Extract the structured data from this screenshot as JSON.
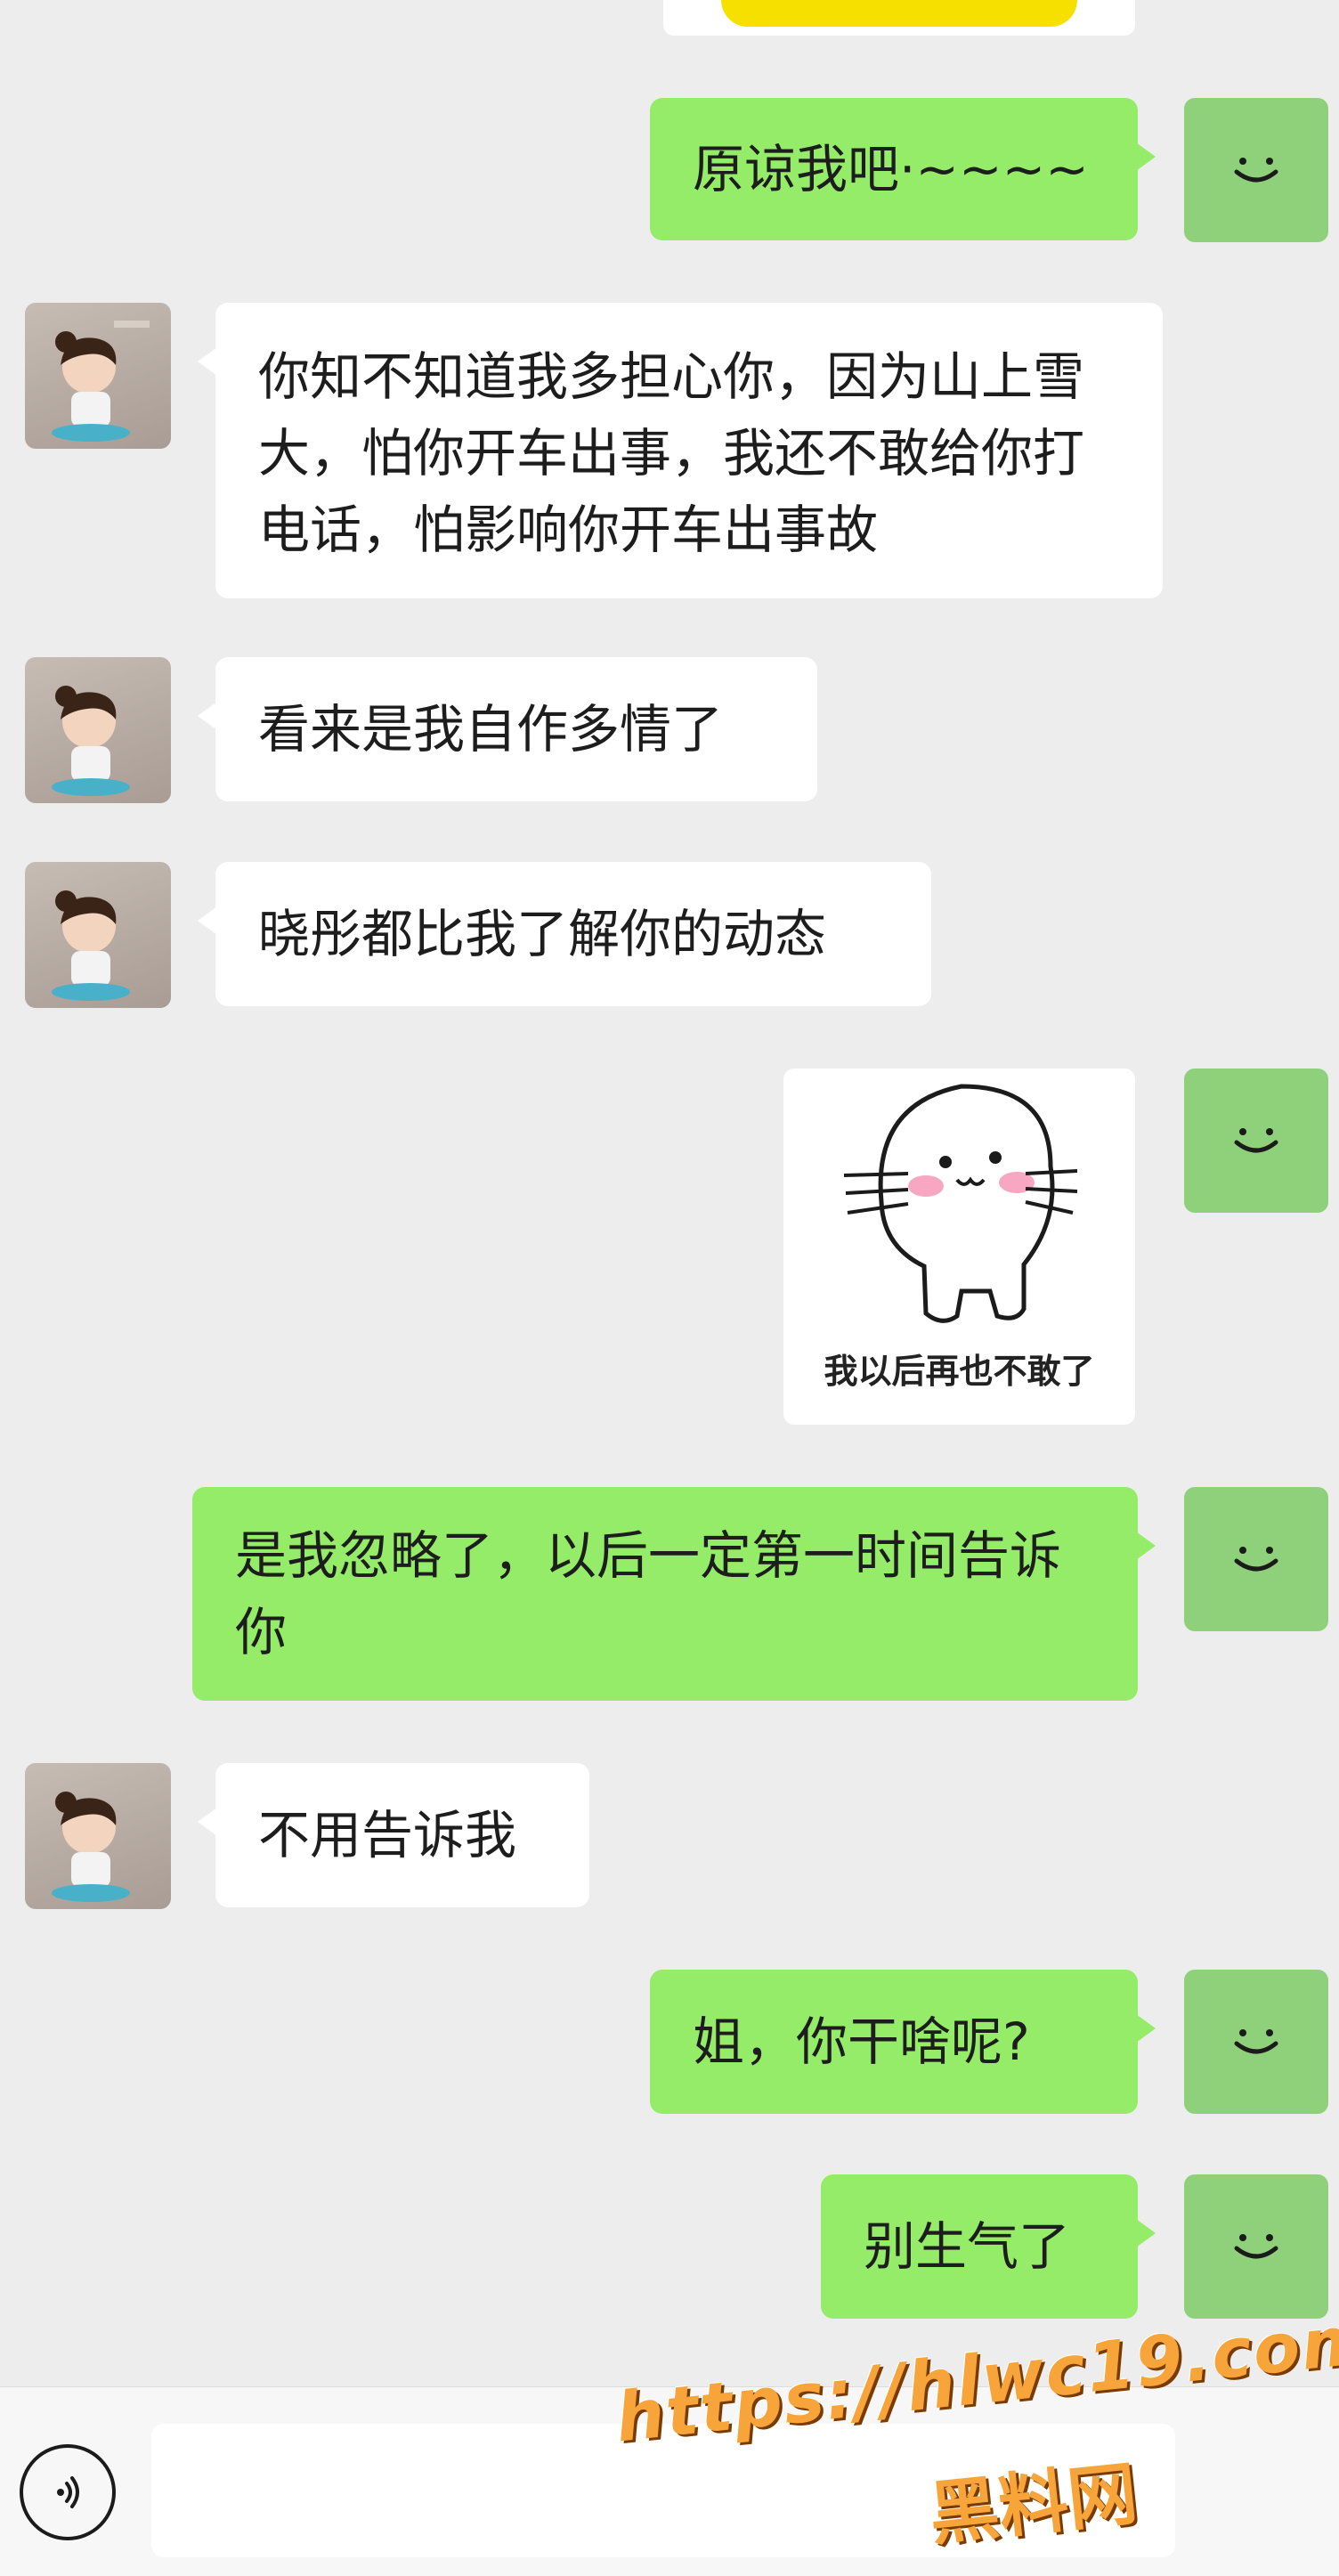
{
  "messages": {
    "m1": "原谅我吧·~~~~",
    "m2": "你知不知道我多担心你，因为山上雪大，怕你开车出事，我还不敢给你打电话，怕影响你开车出事故",
    "m3": "看来是我自作多情了",
    "m4": "晓彤都比我了解你的动态",
    "m6": "是我忽略了，以后一定第一时间告诉你",
    "m7": "不用告诉我",
    "m8": "姐，你干啥呢?",
    "m9": "别生气了"
  },
  "sticker": {
    "caption": "我以后再也不敢了"
  },
  "watermark": {
    "url": "https://hlwc19.com",
    "name": "黑料网"
  },
  "colors": {
    "self_bubble": "#95ec69",
    "other_bubble": "#ffffff",
    "background": "#ededed",
    "watermark": "#f7a43a"
  }
}
